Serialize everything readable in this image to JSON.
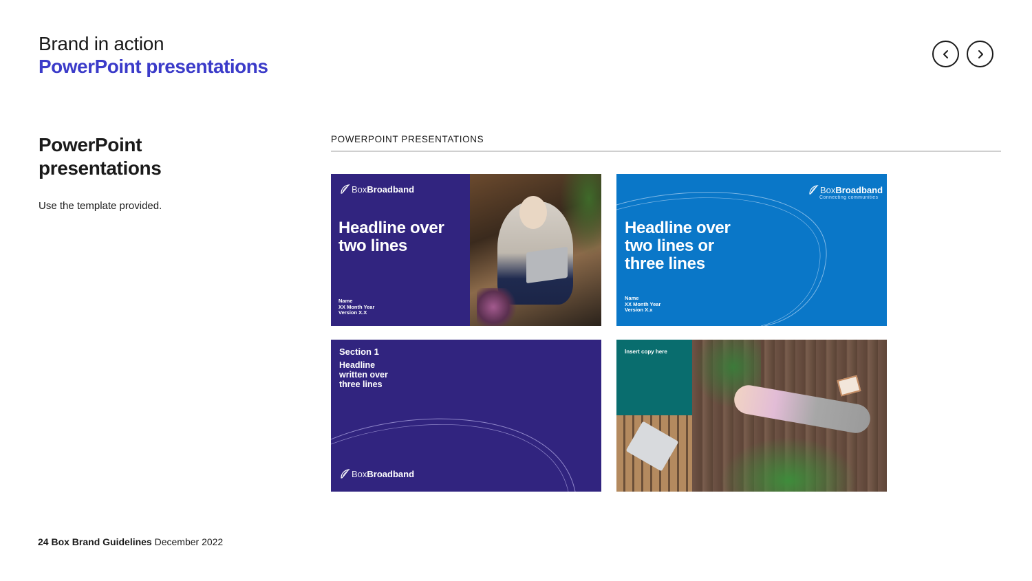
{
  "header": {
    "line1": "Brand in action",
    "line2": "PowerPoint presentations"
  },
  "nav": {
    "prev_icon": "chevron-left-icon",
    "next_icon": "chevron-right-icon"
  },
  "left": {
    "heading_line1": "PowerPoint",
    "heading_line2": "presentations",
    "body": "Use the template provided."
  },
  "section": {
    "label": "POWERPOINT PRESENTATIONS"
  },
  "brand": {
    "box": "Box",
    "broadband": "Broadband",
    "tagline": "Connecting communities"
  },
  "slides": {
    "s1": {
      "headline_line1": "Headline over",
      "headline_line2": "two lines",
      "meta_line1": "Name",
      "meta_line2": "XX Month Year",
      "meta_line3": "Version X.X"
    },
    "s2": {
      "headline_line1": "Headline over",
      "headline_line2": "two lines or",
      "headline_line3": "three lines",
      "meta_line1": "Name",
      "meta_line2": "XX Month Year",
      "meta_line3": "Version X.x"
    },
    "s3": {
      "section": "Section 1",
      "headline_line1": "Headline",
      "headline_line2": "written over",
      "headline_line3": "three lines"
    },
    "s4": {
      "copy": "Insert copy here"
    }
  },
  "footer": {
    "page": "24",
    "title": "Box Brand Guidelines",
    "date": "December 2022"
  },
  "colors": {
    "accent": "#3b3bc9",
    "navy_slide": "#31247f",
    "blue_slide": "#0a77c8",
    "teal_box": "#096d6e"
  }
}
